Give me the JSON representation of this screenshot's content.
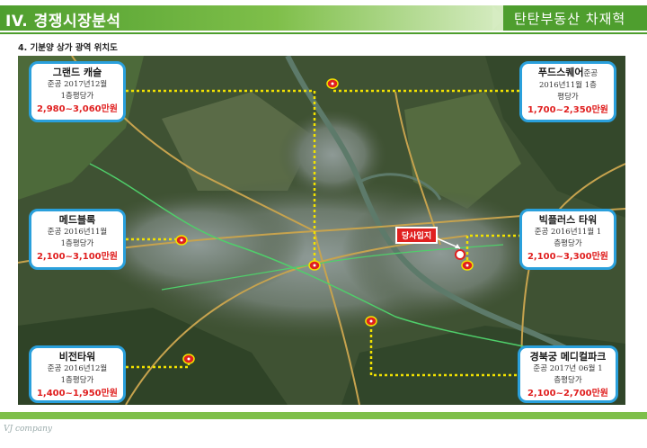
{
  "header": {
    "title": "IV. 경쟁시장분석",
    "brand": "탄탄부동산 차재혁"
  },
  "subtitle": "4. 기분양 상가 광역  위치도",
  "colors": {
    "header_green": "#4e9e2e",
    "callout_border": "#2aa0dc",
    "price_red": "#e02020",
    "connector_yellow": "#f2e200"
  },
  "current_site": "당사입지",
  "callouts": [
    {
      "key": "grand",
      "name": "그랜드 캐슬",
      "line1": "준공 2017년12월",
      "line2": "1층평당가",
      "price": "2,980~3,060만원"
    },
    {
      "key": "food",
      "name": "푸드스퀘어",
      "line0": "준공",
      "line1": "2016년11월  1층",
      "line2": "평당가",
      "price": "1,700~2,350만원"
    },
    {
      "key": "med",
      "name": "메드블록",
      "line1": "준공 2016년11월",
      "line2": "1층평당가",
      "price": "2,100~3,100만원"
    },
    {
      "key": "big",
      "name": "빅플러스 타워",
      "line1": "준공 2016년11월  1",
      "line2": "층평당가",
      "price": "2,100~3,300만원"
    },
    {
      "key": "vision",
      "name": "비전타워",
      "line1": "준공 2016년12월",
      "line2": "1층평당가",
      "price": "1,400~1,950만원"
    },
    {
      "key": "gyeongbuk",
      "name": "경북궁 메디컬파크",
      "line1": "준공 2017년 06월  1",
      "line2": "층평당가",
      "price": "2,100~2,700만원"
    }
  ],
  "footer": "VJ company"
}
